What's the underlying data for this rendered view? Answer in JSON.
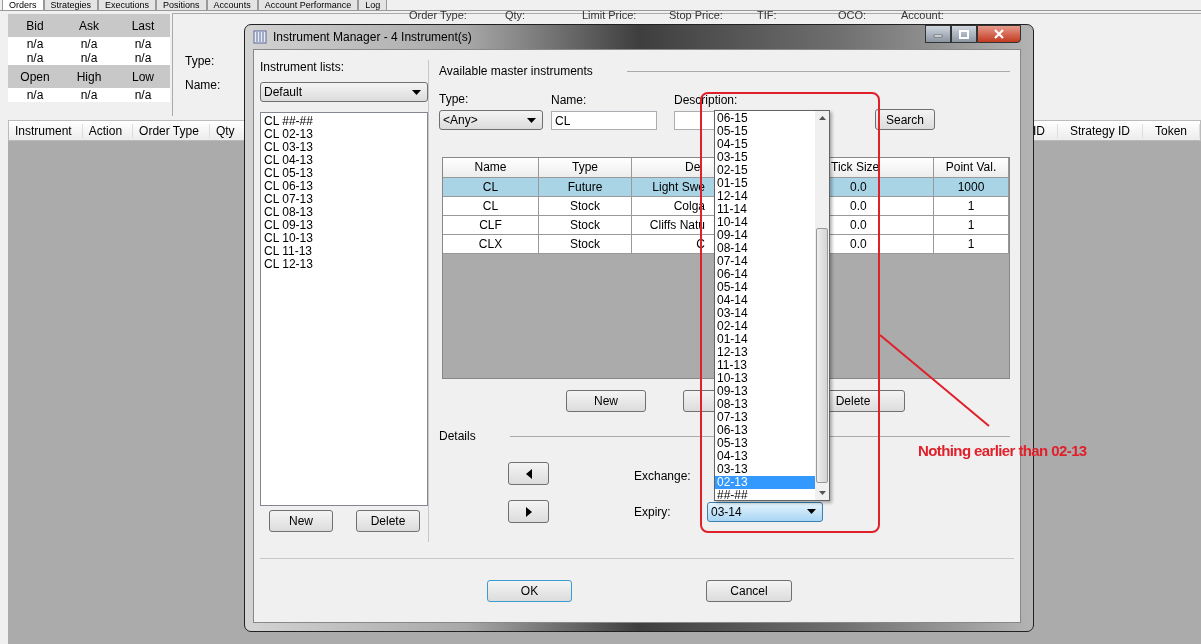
{
  "app_tabs": [
    {
      "label": "Orders",
      "selected": true
    },
    {
      "label": "Strategies",
      "selected": false
    },
    {
      "label": "Executions",
      "selected": false
    },
    {
      "label": "Positions",
      "selected": false
    },
    {
      "label": "Accounts",
      "selected": false
    },
    {
      "label": "Account Performance",
      "selected": false
    },
    {
      "label": "Log",
      "selected": false
    }
  ],
  "quote_panel": [
    {
      "kind": "header",
      "cells": [
        "Bid",
        "Ask",
        "Last"
      ]
    },
    {
      "kind": "values",
      "cells": [
        "n/a",
        "n/a",
        "n/a"
      ]
    },
    {
      "kind": "values",
      "cells": [
        "n/a",
        "n/a",
        "n/a"
      ]
    },
    {
      "kind": "header",
      "cells": [
        "Open",
        "High",
        "Low"
      ]
    },
    {
      "kind": "values",
      "cells": [
        "n/a",
        "n/a",
        "n/a"
      ]
    }
  ],
  "order_form": {
    "labels": [
      "Order Type:",
      "Qty:",
      "Limit Price:",
      "Stop Price:",
      "TIF:",
      "OCO:",
      "Account:"
    ],
    "type_label": "Type:",
    "name_label": "Name:"
  },
  "orders_table": {
    "columns_left": [
      "Instrument",
      "Action",
      "Order Type",
      "Qty"
    ],
    "columns_right": [
      "ID",
      "Strategy ID",
      "Token"
    ]
  },
  "dialog": {
    "title": "Instrument Manager - 4 Instrument(s)",
    "lists_label": "Instrument lists:",
    "list_select": "Default",
    "list_items": [
      "CL ##-##",
      "CL 02-13",
      "CL 03-13",
      "CL 04-13",
      "CL 05-13",
      "CL 06-13",
      "CL 07-13",
      "CL 08-13",
      "CL 09-13",
      "CL 10-13",
      "CL 11-13",
      "CL 12-13"
    ],
    "list_buttons": [
      "New",
      "Delete"
    ],
    "section_title": "Available master instruments",
    "type_label": "Type:",
    "type_value": "<Any>",
    "name_label": "Name:",
    "name_value": "CL",
    "description_label": "Description:",
    "search_button": "Search",
    "table": {
      "columns": [
        "Name",
        "Type",
        "De",
        "Tick Size",
        "Point Val."
      ],
      "rows": [
        {
          "cells": [
            "CL",
            "Future",
            "Light Swe",
            "0.0",
            "1000"
          ],
          "selected": true
        },
        {
          "cells": [
            "CL",
            "Stock",
            "Colga",
            "0.0",
            "1"
          ],
          "selected": false
        },
        {
          "cells": [
            "CLF",
            "Stock",
            "Cliffs Natu",
            "0.0",
            "1"
          ],
          "selected": false
        },
        {
          "cells": [
            "CLX",
            "Stock",
            "C",
            "0.0",
            "1"
          ],
          "selected": false
        }
      ]
    },
    "table_buttons": [
      "New",
      "Delete"
    ],
    "details_title": "Details",
    "exchange_label": "Exchange:",
    "expiry_label": "Expiry:",
    "expiry_value": "03-14",
    "expiry_options": [
      {
        "label": "06-15",
        "selected": false
      },
      {
        "label": "05-15",
        "selected": false
      },
      {
        "label": "04-15",
        "selected": false
      },
      {
        "label": "03-15",
        "selected": false
      },
      {
        "label": "02-15",
        "selected": false
      },
      {
        "label": "01-15",
        "selected": false
      },
      {
        "label": "12-14",
        "selected": false
      },
      {
        "label": "11-14",
        "selected": false
      },
      {
        "label": "10-14",
        "selected": false
      },
      {
        "label": "09-14",
        "selected": false
      },
      {
        "label": "08-14",
        "selected": false
      },
      {
        "label": "07-14",
        "selected": false
      },
      {
        "label": "06-14",
        "selected": false
      },
      {
        "label": "05-14",
        "selected": false
      },
      {
        "label": "04-14",
        "selected": false
      },
      {
        "label": "03-14",
        "selected": false
      },
      {
        "label": "02-14",
        "selected": false
      },
      {
        "label": "01-14",
        "selected": false
      },
      {
        "label": "12-13",
        "selected": false
      },
      {
        "label": "11-13",
        "selected": false
      },
      {
        "label": "10-13",
        "selected": false
      },
      {
        "label": "09-13",
        "selected": false
      },
      {
        "label": "08-13",
        "selected": false
      },
      {
        "label": "07-13",
        "selected": false
      },
      {
        "label": "06-13",
        "selected": false
      },
      {
        "label": "05-13",
        "selected": false
      },
      {
        "label": "04-13",
        "selected": false
      },
      {
        "label": "03-13",
        "selected": false
      },
      {
        "label": "02-13",
        "selected": true
      },
      {
        "label": "##-##",
        "selected": false
      }
    ],
    "ok_button": "OK",
    "cancel_button": "Cancel"
  },
  "annotation": {
    "text": "Nothing earlier than 02-13"
  }
}
